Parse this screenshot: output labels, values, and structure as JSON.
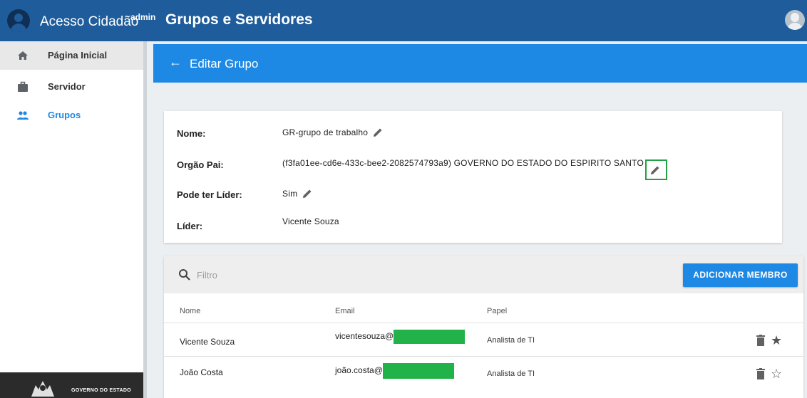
{
  "header": {
    "app_title": "Acesso Cidadão",
    "app_badge": "admin",
    "page_title": "Grupos e Servidores"
  },
  "sidebar": {
    "items": [
      {
        "label": "Página Inicial",
        "icon": "home-icon"
      },
      {
        "label": "Servidor",
        "icon": "briefcase-icon"
      },
      {
        "label": "Grupos",
        "icon": "people-icon"
      }
    ],
    "footer_text": "GOVERNO DO ESTADO"
  },
  "edit_header": {
    "back_icon": "arrow-left-icon",
    "title": "Editar Grupo"
  },
  "group": {
    "nome_label": "Nome:",
    "nome_value": "GR-grupo de trabalho",
    "orgao_label": "Orgão Pai:",
    "orgao_value": "(f3fa01ee-cd6e-433c-bee2-2082574793a9) GOVERNO DO ESTADO DO ESPIRITO SANTO",
    "lider_flag_label": "Pode ter Líder:",
    "lider_flag_value": "Sim",
    "lider_label": "Líder:",
    "lider_value": "Vicente Souza"
  },
  "members": {
    "filter_placeholder": "Filtro",
    "add_button": "ADICIONAR MEMBRO",
    "columns": [
      "Nome",
      "Email",
      "Papel"
    ],
    "rows": [
      {
        "nome": "Vicente Souza",
        "email": "vicentesouza@",
        "papel": "Analista de TI",
        "starred": true
      },
      {
        "nome": "João Costa",
        "email": "joão.costa@",
        "papel": "Analista de TI",
        "starred": false
      }
    ]
  },
  "colors": {
    "topbar": "#1f5c9b",
    "primary": "#1e88e5",
    "highlight": "#21a045",
    "redaction": "#21b24a"
  }
}
